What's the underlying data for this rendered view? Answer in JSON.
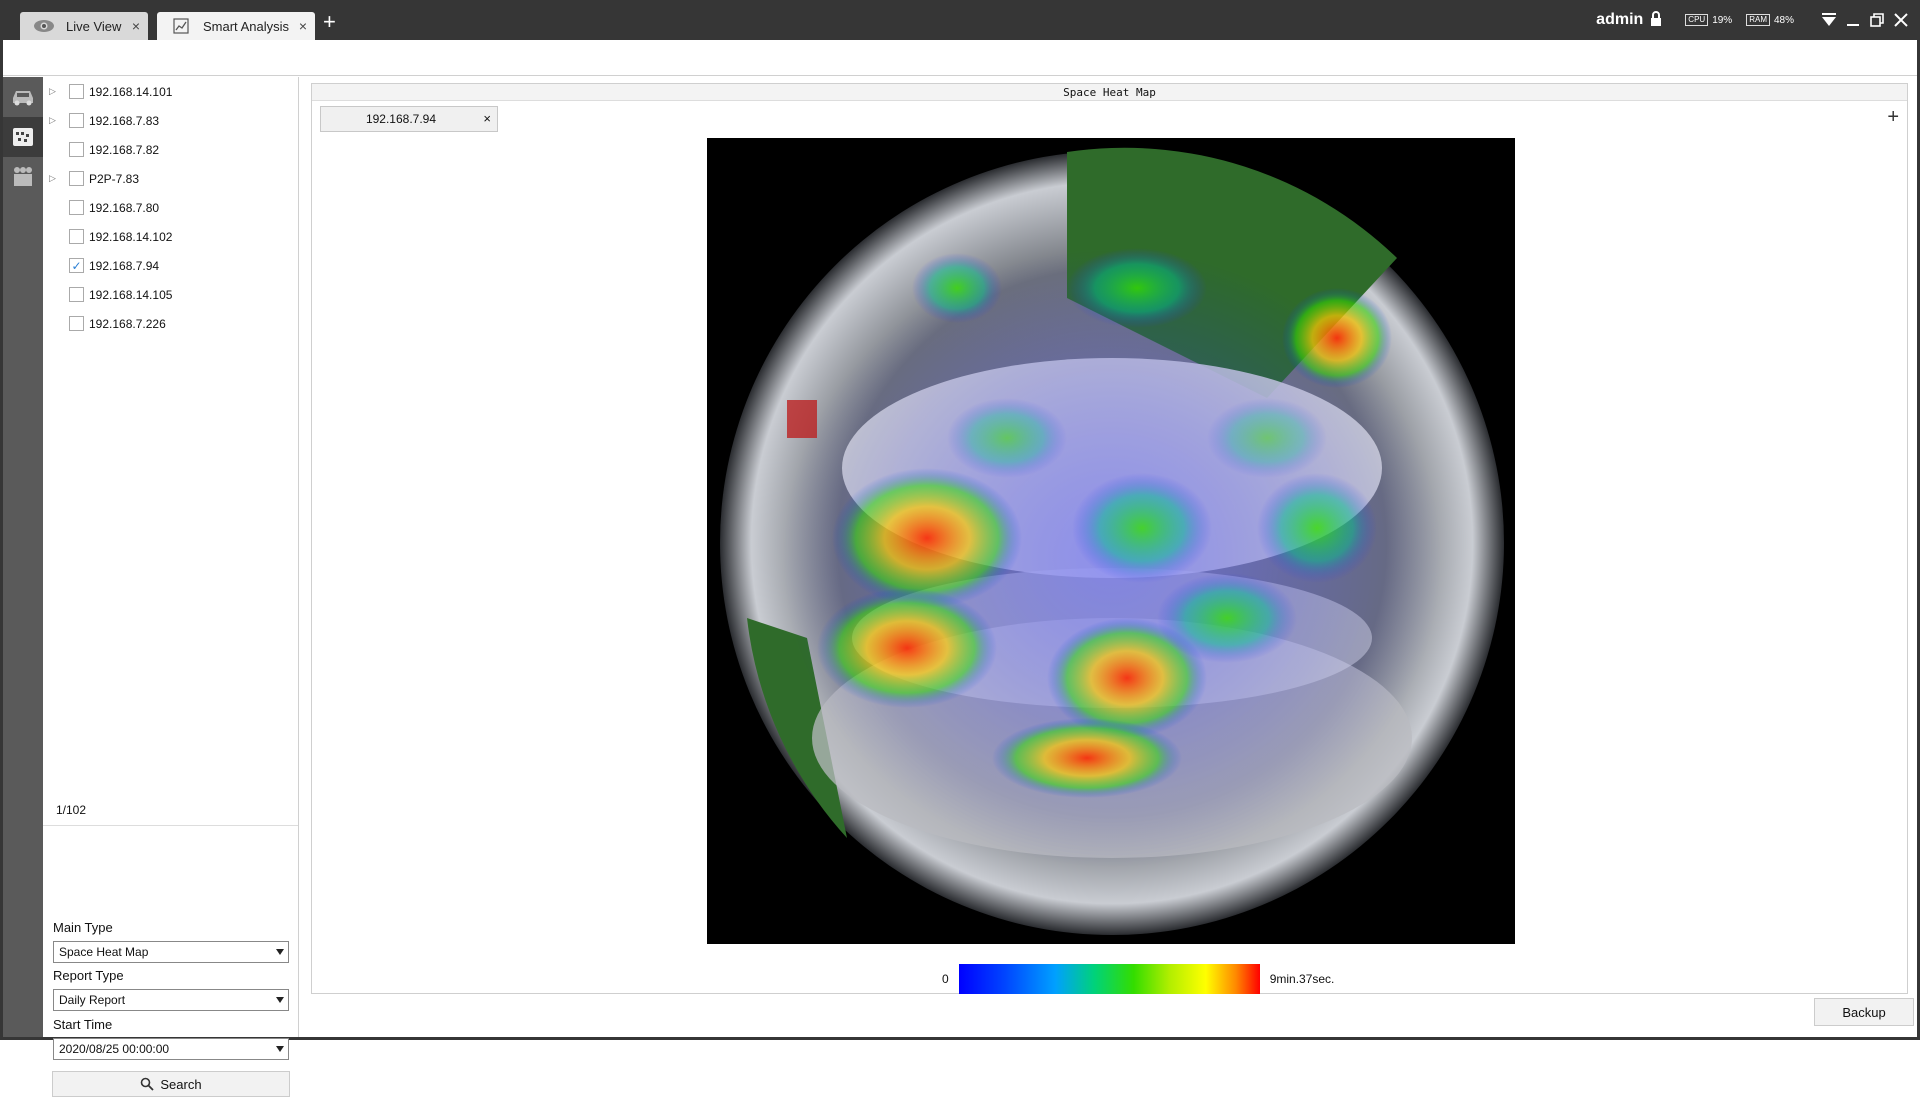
{
  "tabs": [
    {
      "label": "Live View",
      "icon": "eye-icon",
      "active": false
    },
    {
      "label": "Smart Analysis",
      "icon": "chart-icon",
      "active": true
    }
  ],
  "status": {
    "user": "admin",
    "cpu_label": "CPU",
    "cpu": "19%",
    "ram_label": "RAM",
    "ram": "48%"
  },
  "rail": [
    "vehicle-icon",
    "heatmap-icon",
    "people-counting-icon"
  ],
  "devices": [
    {
      "name": "192.168.14.101",
      "expandable": true,
      "checked": false
    },
    {
      "name": "192.168.7.83",
      "expandable": true,
      "checked": false
    },
    {
      "name": "192.168.7.82",
      "expandable": false,
      "checked": false
    },
    {
      "name": "P2P-7.83",
      "expandable": true,
      "checked": false
    },
    {
      "name": "192.168.7.80",
      "expandable": false,
      "checked": false
    },
    {
      "name": "192.168.14.102",
      "expandable": false,
      "checked": false
    },
    {
      "name": "192.168.7.94",
      "expandable": false,
      "checked": true
    },
    {
      "name": "192.168.14.105",
      "expandable": false,
      "checked": false
    },
    {
      "name": "192.168.7.226",
      "expandable": false,
      "checked": false
    }
  ],
  "pager": "1/102",
  "filters": {
    "main_type_label": "Main Type",
    "main_type_value": "Space Heat Map",
    "report_type_label": "Report Type",
    "report_type_value": "Daily Report",
    "start_time_label": "Start Time",
    "start_time_value": "2020/08/25 00:00:00",
    "search_label": "Search"
  },
  "panel": {
    "title": "Space Heat Map",
    "channel_tab": "192.168.7.94",
    "legend_min": "0",
    "legend_max": "9min.37sec."
  },
  "backup_label": "Backup"
}
